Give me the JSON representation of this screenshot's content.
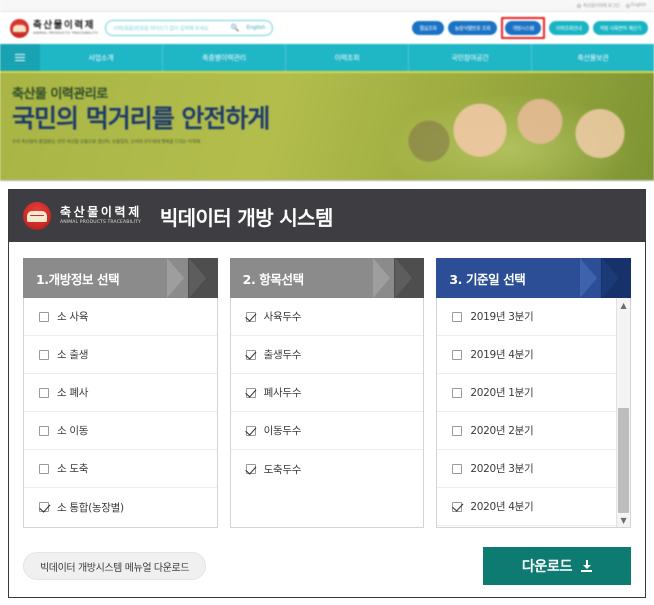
{
  "site": {
    "utility": {
      "login_label": "축산물이력제 로그인",
      "language_label": "English"
    },
    "brand": {
      "name_kr": "축산물이력제",
      "name_en": "ANIMAL PRODUCTS TRACEABILITY"
    },
    "search": {
      "placeholder": "이력(묶음)번호를 띄어쓰기 없이 입력해 주세요",
      "icon": "search-icon",
      "english_label": "English"
    },
    "nav_pills": [
      {
        "label": "멸실조회",
        "color": "#1a72c4",
        "highlighted": false
      },
      {
        "label": "농장식별번호 조회",
        "color": "#1a72c4",
        "highlighted": false
      },
      {
        "label": "개방시스템",
        "color": "#1a72c4",
        "highlighted": true
      },
      {
        "label": "이력조회안내",
        "color": "#18b4c4",
        "highlighted": false
      },
      {
        "label": "적정 사육면적 계산기",
        "color": "#18b4c4",
        "highlighted": false
      }
    ],
    "highlight_color": "#e8201b",
    "gnb": {
      "menu_icon": "hamburger-menu-icon",
      "items": [
        {
          "label": "사업소개"
        },
        {
          "label": "축종별이력관리"
        },
        {
          "label": "이력조회"
        },
        {
          "label": "국민참여공간"
        },
        {
          "label": "축산물보관"
        }
      ]
    },
    "hero": {
      "line1": "축산물 이력관리로",
      "line2": "국민의 먹거리를 안전하게",
      "sub": "우리 축산물의 품질향상, 안전 축산물 유통으로 생산자, 유통업자, 소비자 모두에게 행복을 드리는 이력제"
    }
  },
  "card": {
    "brand_kr": "축산물이력제",
    "brand_en": "ANIMAL PRODUCTS TRACEABILITY",
    "title": "빅데이터 개방 시스템",
    "columns": [
      {
        "step_label": "1.개방정보 선택",
        "theme": "gray",
        "scrollable": false,
        "options": [
          {
            "label": "소 사육",
            "checked": false
          },
          {
            "label": "소 출생",
            "checked": false
          },
          {
            "label": "소 폐사",
            "checked": false
          },
          {
            "label": "소 이동",
            "checked": false
          },
          {
            "label": "소 도축",
            "checked": false
          },
          {
            "label": "소 통합(농장별)",
            "checked": true
          }
        ]
      },
      {
        "step_label": "2. 항목선택",
        "theme": "gray",
        "scrollable": false,
        "options": [
          {
            "label": "사육두수",
            "checked": true
          },
          {
            "label": "출생두수",
            "checked": true
          },
          {
            "label": "폐사두수",
            "checked": true
          },
          {
            "label": "이동두수",
            "checked": true
          },
          {
            "label": "도축두수",
            "checked": true
          }
        ]
      },
      {
        "step_label": "3. 기준일 선택",
        "theme": "blue",
        "scrollable": true,
        "options": [
          {
            "label": "2019년 3분기",
            "checked": false
          },
          {
            "label": "2019년 4분기",
            "checked": false
          },
          {
            "label": "2020년 1분기",
            "checked": false
          },
          {
            "label": "2020년 2분기",
            "checked": false
          },
          {
            "label": "2020년 3분기",
            "checked": false
          },
          {
            "label": "2020년 4분기",
            "checked": true
          }
        ]
      }
    ],
    "footer": {
      "manual_label": "빅데이터 개방시스템 메뉴얼 다운로드",
      "download_label": "다운로드",
      "download_icon": "download-icon"
    }
  }
}
